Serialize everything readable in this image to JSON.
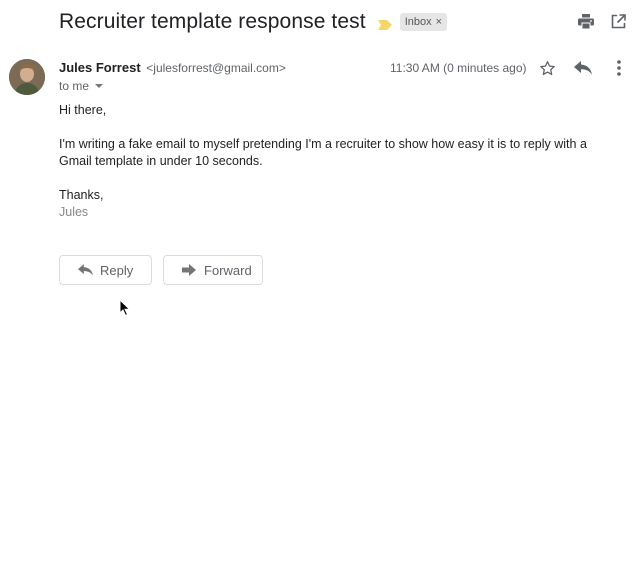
{
  "email": {
    "subject": "Recruiter template response test",
    "label_chip": "Inbox",
    "label_chip_close": "×",
    "sender_name": "Jules Forrest",
    "sender_email": "<julesforrest@gmail.com>",
    "recipient": "to me",
    "timestamp": "11:30 AM (0 minutes ago)",
    "greeting": "Hi there,",
    "body": "I'm writing a fake email to myself pretending I'm a recruiter to show how easy it is to reply with a Gmail template in under 10 seconds.",
    "signoff": "Thanks,",
    "signature": "Jules"
  },
  "actions": {
    "reply_label": "Reply",
    "forward_label": "Forward"
  },
  "icons": {
    "importance": "importance-marker-icon",
    "print": "print-icon",
    "popout": "open-in-new-window-icon",
    "star": "star-icon",
    "reply": "reply-icon",
    "more": "more-vert-icon",
    "forward": "forward-icon"
  },
  "colors": {
    "importance_marker": "#f4d66a",
    "label_chip_bg": "#e6e6e6",
    "icon_gray": "#5f6368",
    "signature_text": "#888888"
  }
}
